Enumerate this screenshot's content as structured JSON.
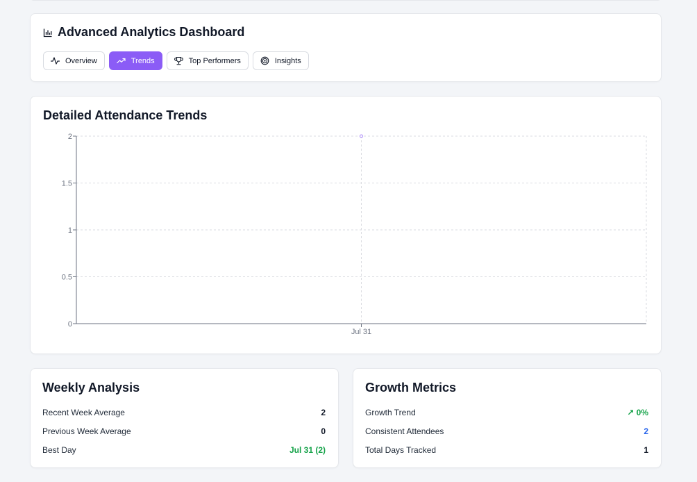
{
  "header": {
    "title": "Advanced Analytics Dashboard",
    "tabs": [
      {
        "label": "Overview",
        "icon": "activity-icon",
        "active": false
      },
      {
        "label": "Trends",
        "icon": "trending-up-icon",
        "active": true
      },
      {
        "label": "Top Performers",
        "icon": "trophy-icon",
        "active": false
      },
      {
        "label": "Insights",
        "icon": "target-icon",
        "active": false
      }
    ]
  },
  "chart_card": {
    "title": "Detailed Attendance Trends"
  },
  "chart_data": {
    "type": "line",
    "categories": [
      "Jul 31"
    ],
    "series": [
      {
        "values": [
          2
        ],
        "color": "#8b5cf6"
      }
    ],
    "ylim": [
      0,
      2
    ],
    "yticks": [
      "0",
      "0.5",
      "1",
      "1.5",
      "2"
    ],
    "grid": true
  },
  "weekly": {
    "title": "Weekly Analysis",
    "rows": [
      {
        "label": "Recent Week Average",
        "value": "2"
      },
      {
        "label": "Previous Week Average",
        "value": "0"
      },
      {
        "label": "Best Day",
        "value": "Jul 31 (2)"
      }
    ]
  },
  "growth": {
    "title": "Growth Metrics",
    "rows": [
      {
        "label": "Growth Trend",
        "value": "↗ 0%"
      },
      {
        "label": "Consistent Attendees",
        "value": "2"
      },
      {
        "label": "Total Days Tracked",
        "value": "1"
      }
    ]
  },
  "colors": {
    "accent": "#8b5cf6",
    "positive": "#16a34a",
    "info": "#2563eb"
  }
}
